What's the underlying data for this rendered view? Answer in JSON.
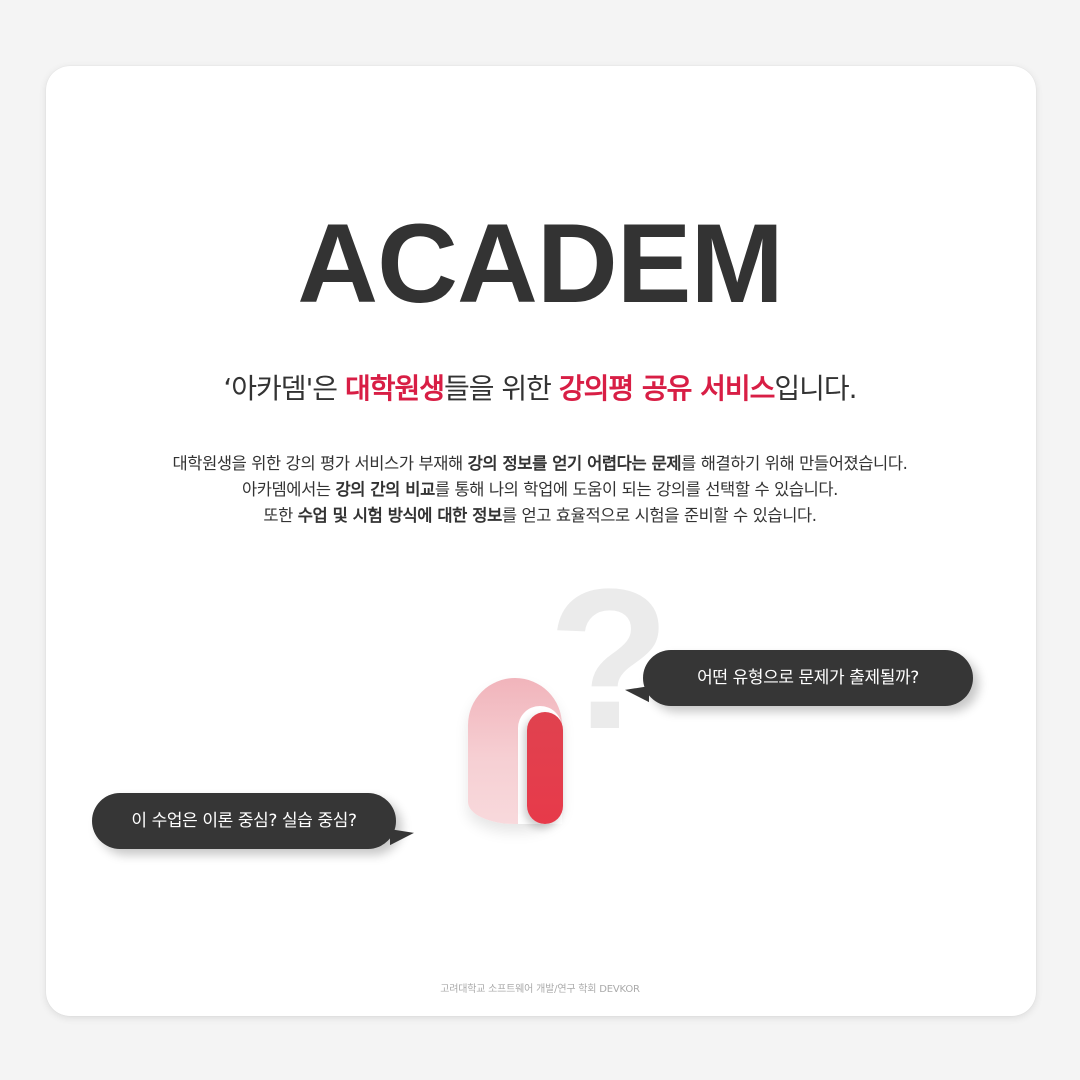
{
  "brand": "ACADEM",
  "tagline": {
    "part1": "‘아카뎀'은 ",
    "hl1": "대학원생",
    "part2": "들을 위한 ",
    "hl2": "강의평 공유 서비스",
    "part3": "입니다."
  },
  "description": {
    "line1": {
      "a": "대학원생을 위한 강의 평가 서비스가 부재해 ",
      "b": "강의 정보를 얻기 어렵다는 문제",
      "c": "를 해결하기 위해 만들어졌습니다."
    },
    "line2": {
      "a": "아카뎀에서는 ",
      "b": "강의 간의 비교",
      "c": "를 통해 나의 학업에 도움이 되는 강의를 선택할 수 있습니다."
    },
    "line3": {
      "a": "또한 ",
      "b": "수업 및 시험 방식에 대한 정보",
      "c": "를 얻고 효율적으로 시험을 준비할 수 있습니다."
    }
  },
  "illustration": {
    "question_mark": "?",
    "accent_color": "#d81e45"
  },
  "bubbles": {
    "right": "어떤 유형으로 문제가 출제될까?",
    "left": "이 수업은 이론 중심? 실습 중심?"
  },
  "footer": "고려대학교 소프트웨어 개발/연구 학회 DEVKOR"
}
